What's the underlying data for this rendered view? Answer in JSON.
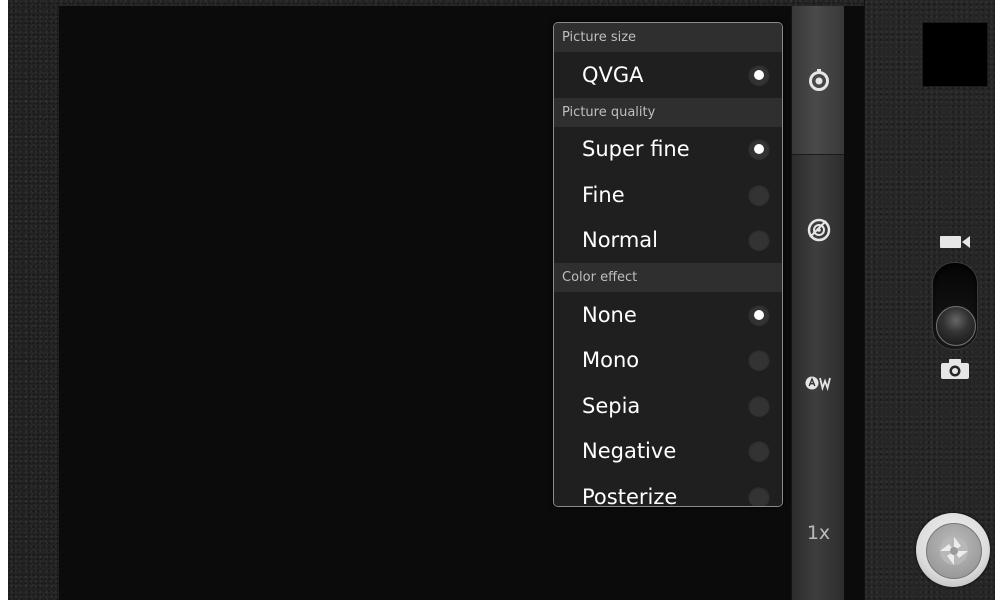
{
  "settings_popup": {
    "sections": [
      {
        "header": "Picture size",
        "items": [
          {
            "label": "QVGA",
            "selected": true
          }
        ]
      },
      {
        "header": "Picture quality",
        "items": [
          {
            "label": "Super fine",
            "selected": true
          },
          {
            "label": "Fine",
            "selected": false
          },
          {
            "label": "Normal",
            "selected": false
          }
        ]
      },
      {
        "header": "Color effect",
        "items": [
          {
            "label": "None",
            "selected": true
          },
          {
            "label": "Mono",
            "selected": false
          },
          {
            "label": "Sepia",
            "selected": false
          },
          {
            "label": "Negative",
            "selected": false
          },
          {
            "label": "Posterize",
            "selected": false
          }
        ]
      }
    ]
  },
  "settings_bar": {
    "items": [
      {
        "icon": "camera-settings-icon",
        "active": true
      },
      {
        "icon": "scene-mode-icon",
        "active": false
      },
      {
        "icon": "white-balance-auto-icon",
        "active": false
      }
    ],
    "zoom_label": "1x"
  },
  "mode_switch": {
    "selected": "camera",
    "top_icon": "video-camera-icon",
    "bottom_icon": "camera-icon"
  },
  "shutter": {
    "icon": "aperture-icon"
  },
  "colors": {
    "accent": "#ffffff",
    "popup_background": "#1f1f1f",
    "section_header_background": "#2f2f2f",
    "viewfinder": "#0b0b0b"
  }
}
